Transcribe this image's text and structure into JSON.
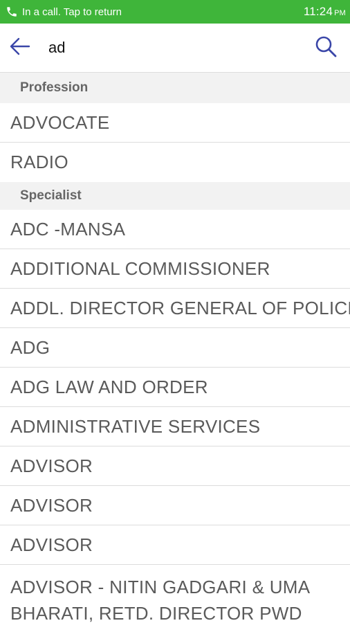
{
  "status_bar": {
    "call_text": "In a call. Tap to return",
    "time": "11:24",
    "ampm": "PM",
    "background_color": "#3fb53a"
  },
  "search": {
    "query": "ad",
    "back_icon": "arrow-left-icon",
    "search_icon": "search-icon",
    "accent_color": "#3a46a8"
  },
  "sections": {
    "profession": {
      "header": "Profession",
      "items": [
        "ADVOCATE",
        "RADIO"
      ]
    },
    "specialist": {
      "header": "Specialist",
      "items": [
        "ADC -MANSA",
        "ADDITIONAL COMMISSIONER",
        "ADDL. DIRECTOR GENERAL OF POLICE",
        "ADG",
        "ADG LAW AND ORDER",
        "ADMINISTRATIVE SERVICES",
        "ADVISOR",
        "ADVISOR",
        "ADVISOR",
        "ADVISOR - NITIN GADGARI & UMA BHARATI, RETD. DIRECTOR PWD"
      ]
    }
  }
}
